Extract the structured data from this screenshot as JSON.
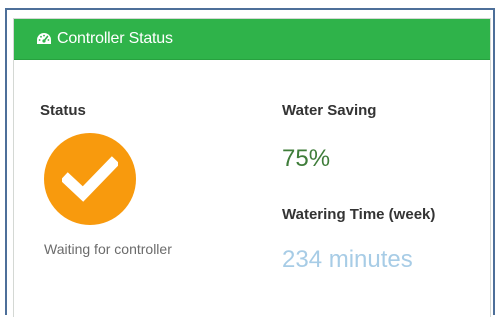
{
  "panel": {
    "title": "Controller Status",
    "title_icon": "dashboard-icon",
    "header_color": "#2fb34a"
  },
  "status": {
    "label": "Status",
    "icon": "checkmark-icon",
    "icon_color": "#f89a0d",
    "text": "Waiting for controller"
  },
  "water_saving": {
    "label": "Water Saving",
    "value": "75%",
    "value_color": "#3f7d3a"
  },
  "watering_time": {
    "label": "Watering Time (week)",
    "value": "234 minutes",
    "value_color": "#a7cce6"
  }
}
